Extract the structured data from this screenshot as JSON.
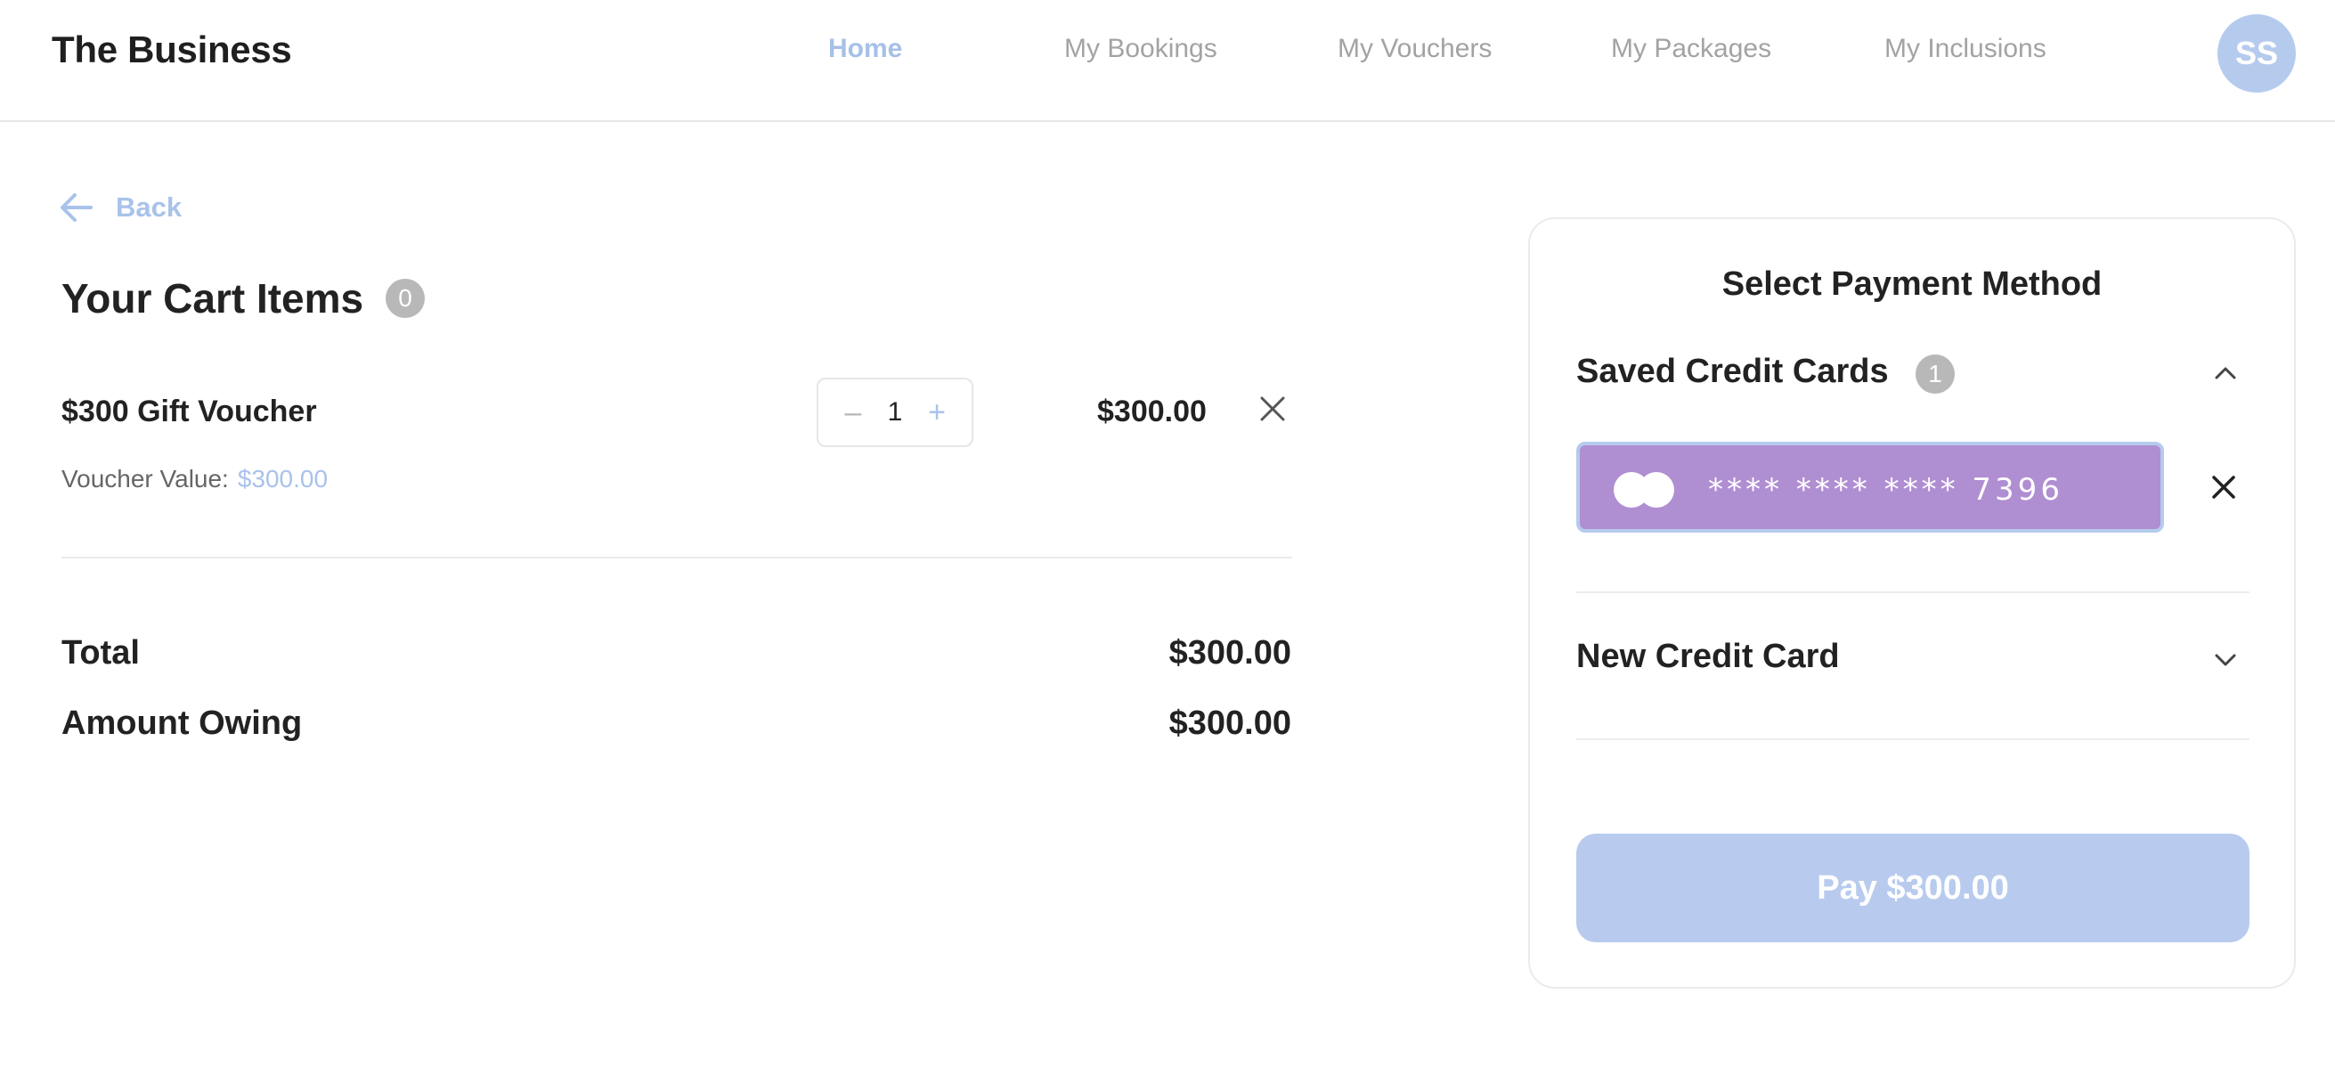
{
  "header": {
    "brand": "The Business",
    "nav": [
      {
        "label": "Home",
        "active": true
      },
      {
        "label": "My Bookings",
        "active": false
      },
      {
        "label": "My Vouchers",
        "active": false
      },
      {
        "label": "My Packages",
        "active": false
      },
      {
        "label": "My Inclusions",
        "active": false
      }
    ],
    "avatar_initials": "SS"
  },
  "back": {
    "label": "Back"
  },
  "cart": {
    "title": "Your Cart Items",
    "count": "0",
    "items": [
      {
        "name": "$300 Gift Voucher",
        "voucher_value_label": "Voucher Value:",
        "voucher_value": "$300.00",
        "quantity": "1",
        "decrement_symbol": "–",
        "increment_symbol": "+",
        "price": "$300.00"
      }
    ],
    "total_label": "Total",
    "total_value": "$300.00",
    "amount_owing_label": "Amount Owing",
    "amount_owing_value": "$300.00"
  },
  "payment": {
    "title": "Select Payment Method",
    "saved_cards_label": "Saved Credit Cards",
    "saved_cards_count": "1",
    "saved_cards": [
      {
        "number": "**** **** **** 7396",
        "brand_icon": "mastercard-icon"
      }
    ],
    "new_card_label": "New Credit Card",
    "pay_button": "Pay $300.00"
  },
  "colors": {
    "accent": "#a9c2ea",
    "avatar_bg": "#b5cbee",
    "card_bg": "#b08ed2",
    "pay_button_bg": "#b8cbee",
    "badge_bg": "#b8b8b8"
  }
}
